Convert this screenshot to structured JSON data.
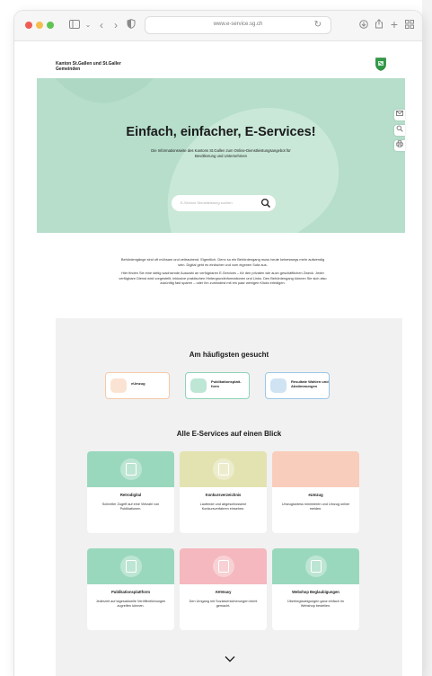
{
  "browser": {
    "url": "www.e-service.sg.ch"
  },
  "header": {
    "canton_name": "Kanton St.Gallen und St.Galler Gemeinden"
  },
  "hero": {
    "title": "Einfach, einfacher, E-Services!",
    "subtitle": "Die Informationsseite des Kantons St.Gallen zum Online-Dienstleistungsangebot für Bevölkerung und Unternehmen",
    "search_placeholder": "E-Service Dienstleistung suchen"
  },
  "intro": {
    "p1": "Behördengänge sind oft mühsam und zeitraubend. Eigentlich. Denn so ein Behördengang muss heute keineswegs mehr aufwendig sein. Digital geht es einfacher und vom eigenen Sofa aus.",
    "p2": "Hier finden Sie eine stetig wachsende Auswahl an verfügbaren E-Services – für den privaten wie auch geschäftlichen Zweck. Jeder verfügbare Dienst wird vorgestellt, inklusive praktischen Hintergrundinformationen und Links. Den Behördengang können Sie sich also zukünftig fast sparen – oder ihn zumindest mit ein paar wenigen Klicks erledigen."
  },
  "popular": {
    "title": "Am häufigsten gesucht",
    "items": [
      {
        "label": "eUmzug",
        "color": "#f5c9a8"
      },
      {
        "label": "Publikationsplatt-form",
        "color": "#8fd3b7"
      },
      {
        "label": "Resultate Wahlen und Abstimmungen",
        "color": "#9cc7e6"
      }
    ]
  },
  "all_services": {
    "title": "Alle E-Services auf einen Blick",
    "cards": [
      {
        "title": "Retrodigital",
        "desc": "Schneller Zugriff auf eine Vielzahl von Publikationen.",
        "color": "#9ad8be"
      },
      {
        "title": "Konkursverzeichnis",
        "desc": "Laufende und abgeschlossene Konkursverfahren einsehen.",
        "color": "#e3e3b2"
      },
      {
        "title": "eUmzug",
        "desc": "Umzugsstress minimieren und Umzug online melden.",
        "color": "#f9cdbb"
      },
      {
        "title": "Publikationsplattform",
        "desc": "Jederzeit auf tagesaktuelle Veröffentlichungen zugreifen können.",
        "color": "#9ad8be"
      },
      {
        "title": "AHVeasy",
        "desc": "Den Umgang mit Sozialversicherungen leicht gemacht.",
        "color": "#f4b8be"
      },
      {
        "title": "Webshop Beglaubigungen",
        "desc": "Überbeglaubigungen ganz einfach im Webshop bestellen.",
        "color": "#9ad8be"
      }
    ]
  },
  "colors": {
    "hero_bg": "#b6decb",
    "section_bg": "#f1f1f1",
    "crest_green": "#2f9a45"
  }
}
